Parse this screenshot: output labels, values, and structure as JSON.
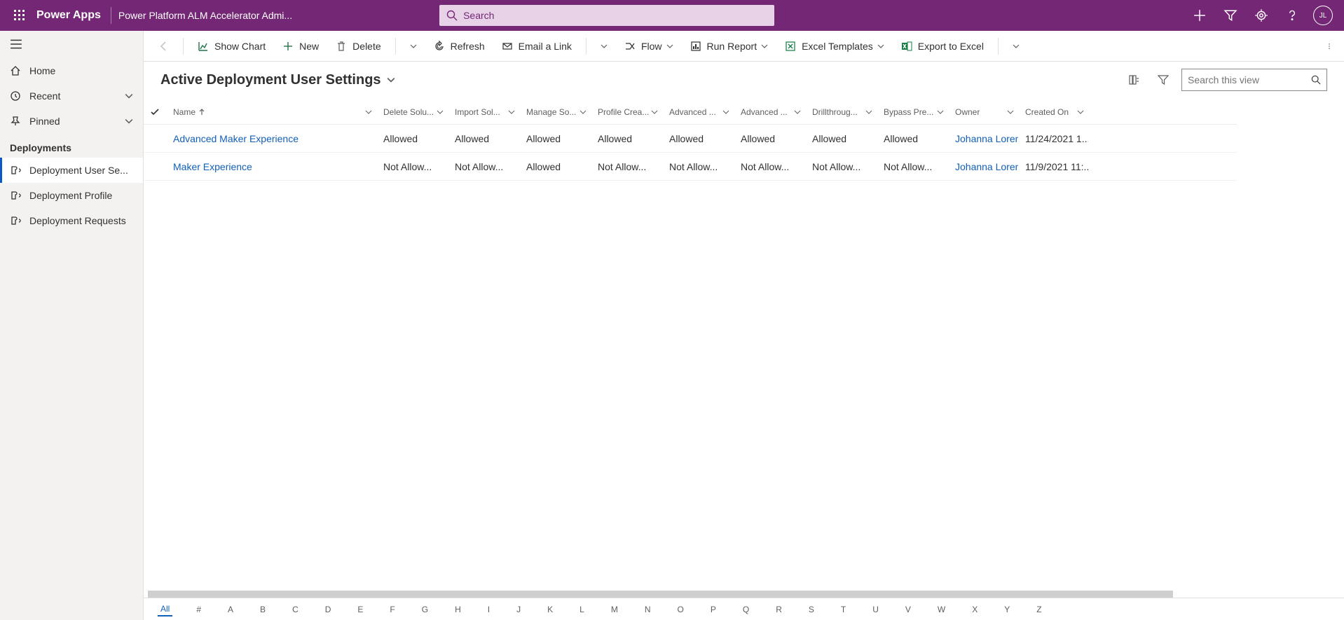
{
  "header": {
    "brand": "Power Apps",
    "appname": "Power Platform ALM Accelerator Admi...",
    "search_placeholder": "Search",
    "avatar_initials": "JL"
  },
  "sidebar": {
    "home": "Home",
    "recent": "Recent",
    "pinned": "Pinned",
    "group": "Deployments",
    "items": [
      {
        "label": "Deployment User Se..."
      },
      {
        "label": "Deployment Profile"
      },
      {
        "label": "Deployment Requests"
      }
    ]
  },
  "commands": {
    "show_chart": "Show Chart",
    "new": "New",
    "delete": "Delete",
    "refresh": "Refresh",
    "email_link": "Email a Link",
    "flow": "Flow",
    "run_report": "Run Report",
    "excel_templates": "Excel Templates",
    "export_excel": "Export to Excel"
  },
  "view": {
    "title": "Active Deployment User Settings",
    "search_placeholder": "Search this view"
  },
  "columns": {
    "name": "Name",
    "delete_solu": "Delete Solu...",
    "import_sol": "Import Sol...",
    "manage_so": "Manage So...",
    "profile_crea": "Profile Crea...",
    "advanced1": "Advanced ...",
    "advanced2": "Advanced ...",
    "drillthroug": "Drillthroug...",
    "bypass_pre": "Bypass Pre...",
    "owner": "Owner",
    "created_on": "Created On"
  },
  "rows": [
    {
      "name": "Advanced Maker Experience",
      "delete_solu": "Allowed",
      "import_sol": "Allowed",
      "manage_so": "Allowed",
      "profile_crea": "Allowed",
      "advanced1": "Allowed",
      "advanced2": "Allowed",
      "drillthroug": "Allowed",
      "bypass_pre": "Allowed",
      "owner": "Johanna Lorenz",
      "created_on": "11/24/2021 1..."
    },
    {
      "name": "Maker Experience",
      "delete_solu": "Not Allow...",
      "import_sol": "Not Allow...",
      "manage_so": "Allowed",
      "profile_crea": "Not Allow...",
      "advanced1": "Not Allow...",
      "advanced2": "Not Allow...",
      "drillthroug": "Not Allow...",
      "bypass_pre": "Not Allow...",
      "owner": "Johanna Lorenz",
      "created_on": "11/9/2021 11:..."
    }
  ],
  "jumpbar": [
    "All",
    "#",
    "A",
    "B",
    "C",
    "D",
    "E",
    "F",
    "G",
    "H",
    "I",
    "J",
    "K",
    "L",
    "M",
    "N",
    "O",
    "P",
    "Q",
    "R",
    "S",
    "T",
    "U",
    "V",
    "W",
    "X",
    "Y",
    "Z"
  ]
}
